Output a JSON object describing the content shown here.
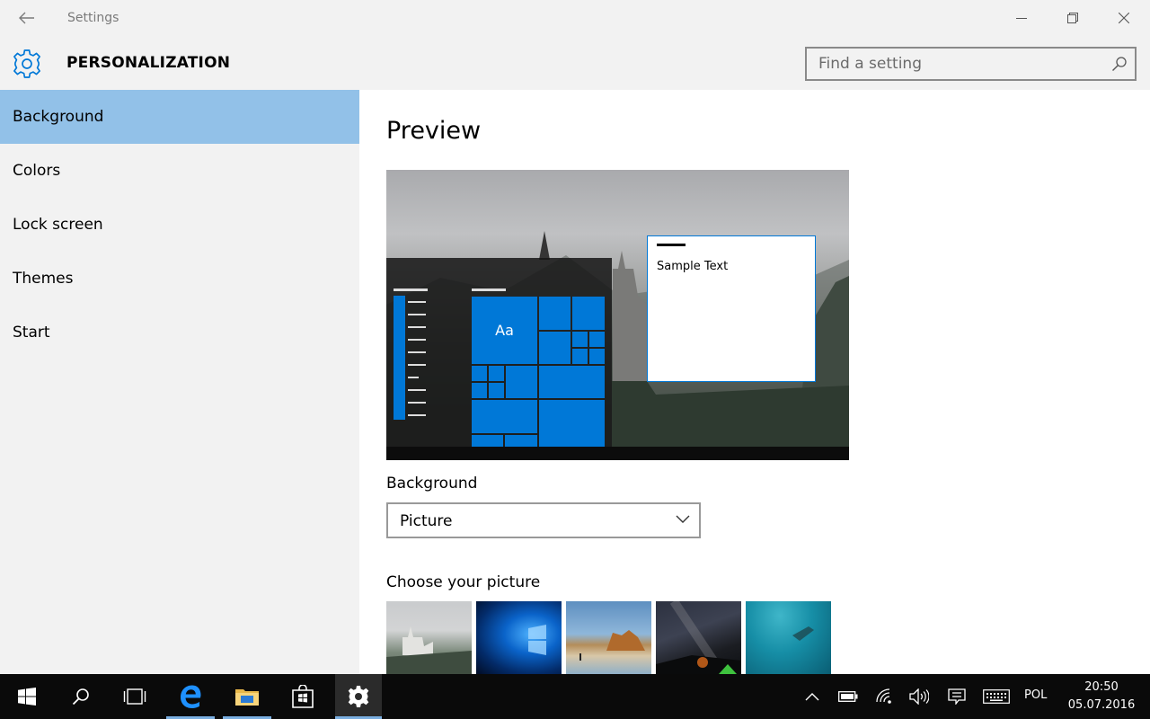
{
  "window": {
    "title": "Settings"
  },
  "header": {
    "section_title": "PERSONALIZATION"
  },
  "search": {
    "placeholder": "Find a setting"
  },
  "sidebar": {
    "items": [
      {
        "label": "Background",
        "active": true
      },
      {
        "label": "Colors",
        "active": false
      },
      {
        "label": "Lock screen",
        "active": false
      },
      {
        "label": "Themes",
        "active": false
      },
      {
        "label": "Start",
        "active": false
      }
    ]
  },
  "main": {
    "preview_heading": "Preview",
    "preview": {
      "tile_label": "Aa",
      "sample_text": "Sample Text"
    },
    "background_label": "Background",
    "background_value": "Picture",
    "choose_label": "Choose your picture",
    "thumbnails": [
      "castle-thumbnail",
      "windows-logo-thumbnail",
      "beach-rocks-thumbnail",
      "night-sky-thumbnail",
      "underwater-swimmer-thumbnail"
    ]
  },
  "colors": {
    "accent": "#0078d7",
    "selected_nav": "#92c1e8",
    "chrome": "#f2f2f2",
    "taskbar": "#0a0a0a"
  },
  "taskbar": {
    "buttons": [
      "windows-start-icon",
      "search-icon",
      "task-view-icon",
      "edge-icon",
      "file-explorer-icon",
      "store-icon",
      "settings-icon"
    ],
    "tray": [
      "show-hidden-icons-chevron",
      "battery-icon",
      "network-icon",
      "volume-icon",
      "action-center-icon",
      "touch-keyboard-icon"
    ],
    "language": "POL",
    "time": "20:50",
    "date": "05.07.2016"
  }
}
